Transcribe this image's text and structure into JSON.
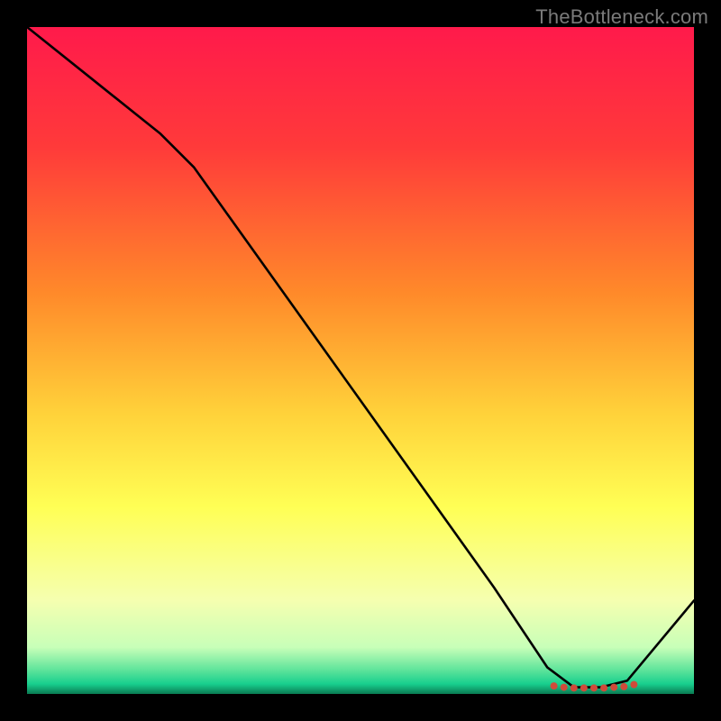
{
  "watermark": "TheBottleneck.com",
  "chart_data": {
    "type": "line",
    "title": "",
    "xlabel": "",
    "ylabel": "",
    "xlim": [
      0,
      100
    ],
    "ylim": [
      0,
      100
    ],
    "grid": false,
    "legend": false,
    "series": [
      {
        "name": "curve",
        "x": [
          0,
          10,
          20,
          25,
          30,
          40,
          50,
          60,
          70,
          78,
          82,
          86,
          90,
          100
        ],
        "y": [
          100,
          92,
          84,
          79,
          72,
          58,
          44,
          30,
          16,
          4,
          1,
          1,
          2,
          14
        ]
      }
    ],
    "markers": {
      "name": "bottom-markers",
      "x": [
        79,
        80.5,
        82,
        83.5,
        85,
        86.5,
        88,
        89.5,
        91
      ],
      "y": [
        1.2,
        1.0,
        0.9,
        0.9,
        0.9,
        0.9,
        1.0,
        1.1,
        1.4
      ],
      "color": "#d04a3a",
      "size": 4
    },
    "background_gradient": {
      "stops": [
        {
          "offset": 0.0,
          "color": "#ff1a4b"
        },
        {
          "offset": 0.18,
          "color": "#ff3a3a"
        },
        {
          "offset": 0.4,
          "color": "#ff8a2a"
        },
        {
          "offset": 0.58,
          "color": "#ffd23a"
        },
        {
          "offset": 0.72,
          "color": "#ffff55"
        },
        {
          "offset": 0.86,
          "color": "#f5ffb0"
        },
        {
          "offset": 0.93,
          "color": "#c8ffb8"
        },
        {
          "offset": 0.965,
          "color": "#5be39a"
        },
        {
          "offset": 0.985,
          "color": "#18cf8e"
        },
        {
          "offset": 1.0,
          "color": "#0a7a52"
        }
      ]
    }
  }
}
